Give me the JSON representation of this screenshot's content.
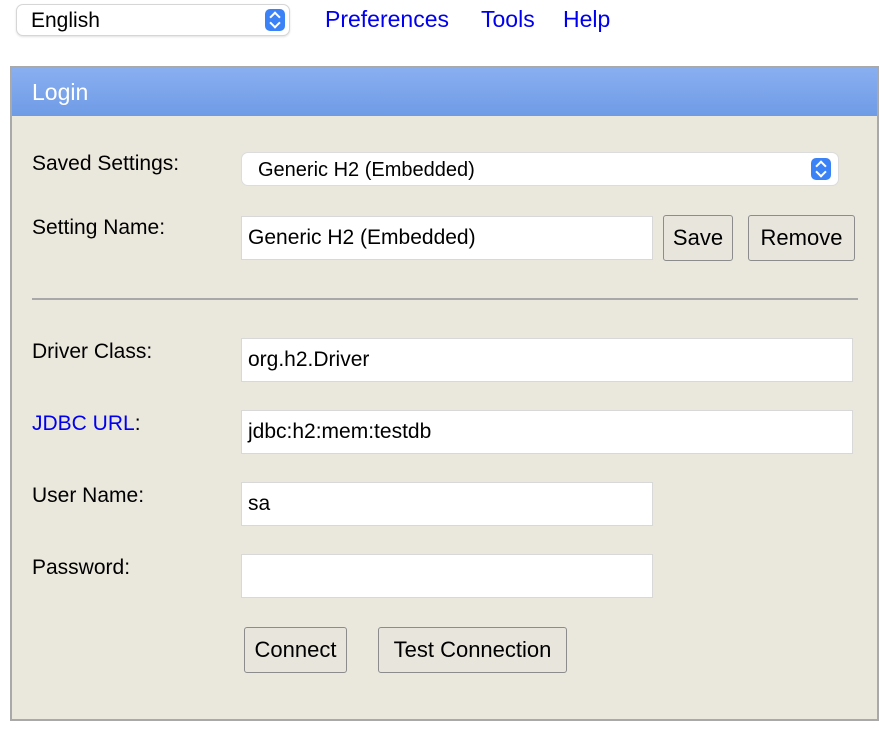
{
  "language_selector": {
    "value": "English",
    "stepper_icon": "updown-chevron-icon"
  },
  "top_nav": {
    "preferences": "Preferences",
    "tools": "Tools",
    "help": "Help"
  },
  "panel": {
    "title": "Login",
    "saved_settings": {
      "label": "Saved Settings:",
      "value": "Generic H2 (Embedded)"
    },
    "setting_name": {
      "label": "Setting Name:",
      "value": "Generic H2 (Embedded)",
      "save": "Save",
      "remove": "Remove"
    },
    "driver_class": {
      "label": "Driver Class:",
      "value": "org.h2.Driver"
    },
    "jdbc_url": {
      "label_link": "JDBC URL",
      "label_suffix": ":",
      "value": "jdbc:h2:mem:testdb"
    },
    "user_name": {
      "label": "User Name:",
      "value": "sa"
    },
    "password": {
      "label": "Password:",
      "value": ""
    },
    "buttons": {
      "connect": "Connect",
      "test_connection": "Test Connection"
    }
  },
  "colors": {
    "link": "#0000ee",
    "header_gradient_top": "#89aff0",
    "header_gradient_bottom": "#6f9be6",
    "panel_bg": "#eae7dc",
    "stepper": "#3b82f6"
  }
}
